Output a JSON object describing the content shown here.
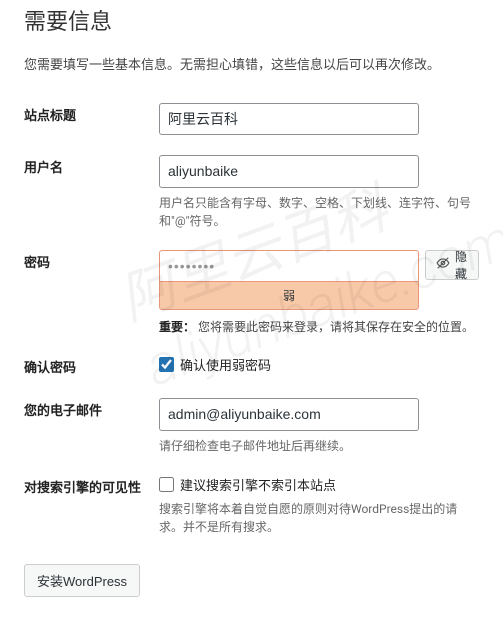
{
  "heading": "需要信息",
  "intro": "您需要填写一些基本信息。无需担心填错，这些信息以后可以再次修改。",
  "fields": {
    "site_title": {
      "label": "站点标题",
      "value": "阿里云百科"
    },
    "username": {
      "label": "用户名",
      "value": "aliyunbaike",
      "hint": "用户名只能含有字母、数字、空格、下划线、连字符、句号和\"@\"符号。"
    },
    "password": {
      "label": "密码",
      "value": "••••••••",
      "strength": "弱",
      "hide_button": "隐藏",
      "important_label": "重要：",
      "important_text": "您将需要此密码来登录，请将其保存在安全的位置。"
    },
    "confirm_password": {
      "label": "确认密码",
      "checkbox_label": "确认使用弱密码",
      "checked": true
    },
    "email": {
      "label": "您的电子邮件",
      "value": "admin@aliyunbaike.com",
      "hint": "请仔细检查电子邮件地址后再继续。"
    },
    "visibility": {
      "label": "对搜索引擎的可见性",
      "checkbox_label": "建议搜索引擎不索引本站点",
      "checked": false,
      "hint": "搜索引擎将本着自觉自愿的原则对待WordPress提出的请求。并不是所有搜求。"
    }
  },
  "submit": "安装WordPress",
  "watermark": {
    "line1": "阿里云百科",
    "line2": "aliyunbaike.com"
  }
}
